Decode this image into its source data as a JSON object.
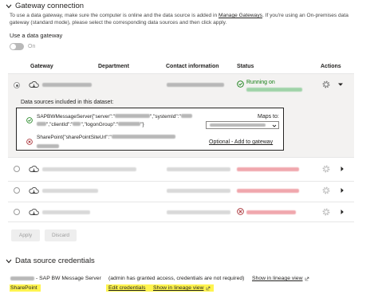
{
  "gateway_section": {
    "title": "Gateway connection",
    "description_part1": "To use a data gateway, make sure the computer is online and the data source is added in",
    "manage_gateways_link": "Manage Gateways",
    "description_part2": ". If you're using an On-premises data gateway (standard mode), please select the corresponding data sources and then click apply.",
    "use_gateway_label": "Use a data gateway",
    "toggle_label": "On",
    "toggle_state": "on"
  },
  "table": {
    "headers": {
      "gateway": "Gateway",
      "department": "Department",
      "contact": "Contact information",
      "status": "Status",
      "actions": "Actions"
    },
    "first_row_status": "Running on"
  },
  "expanded": {
    "title": "Data sources included in this dataset:",
    "source1_line1": "SAPBWMessageServer{\"server\":\"",
    "source1_mid1": "\",\"systemId\":\"",
    "source1_line2_a": "\",\"clientId\":\"",
    "source1_line2_b": "\",\"logonGroup\":\"",
    "source1_line2_end": "\"}",
    "maps_to_label": "Maps to:",
    "source2_text": "SharePoint{\"sharePointSiteUrl\":\"",
    "optional_link": "Optional - Add to gateway"
  },
  "buttons": {
    "apply": "Apply",
    "discard": "Discard"
  },
  "credentials_section": {
    "title": "Data source credentials",
    "row1_name": "- SAP BW Message Server",
    "row1_note": "(admin has granted access, credentials are not required)",
    "row1_link": "Show in lineage view",
    "row2_name": "SharePoint",
    "row2_edit": "Edit credentials",
    "row2_link": "Show in lineage view"
  },
  "colors": {
    "running": "#107c10",
    "error": "#a4262c",
    "highlight": "#fff44f"
  }
}
